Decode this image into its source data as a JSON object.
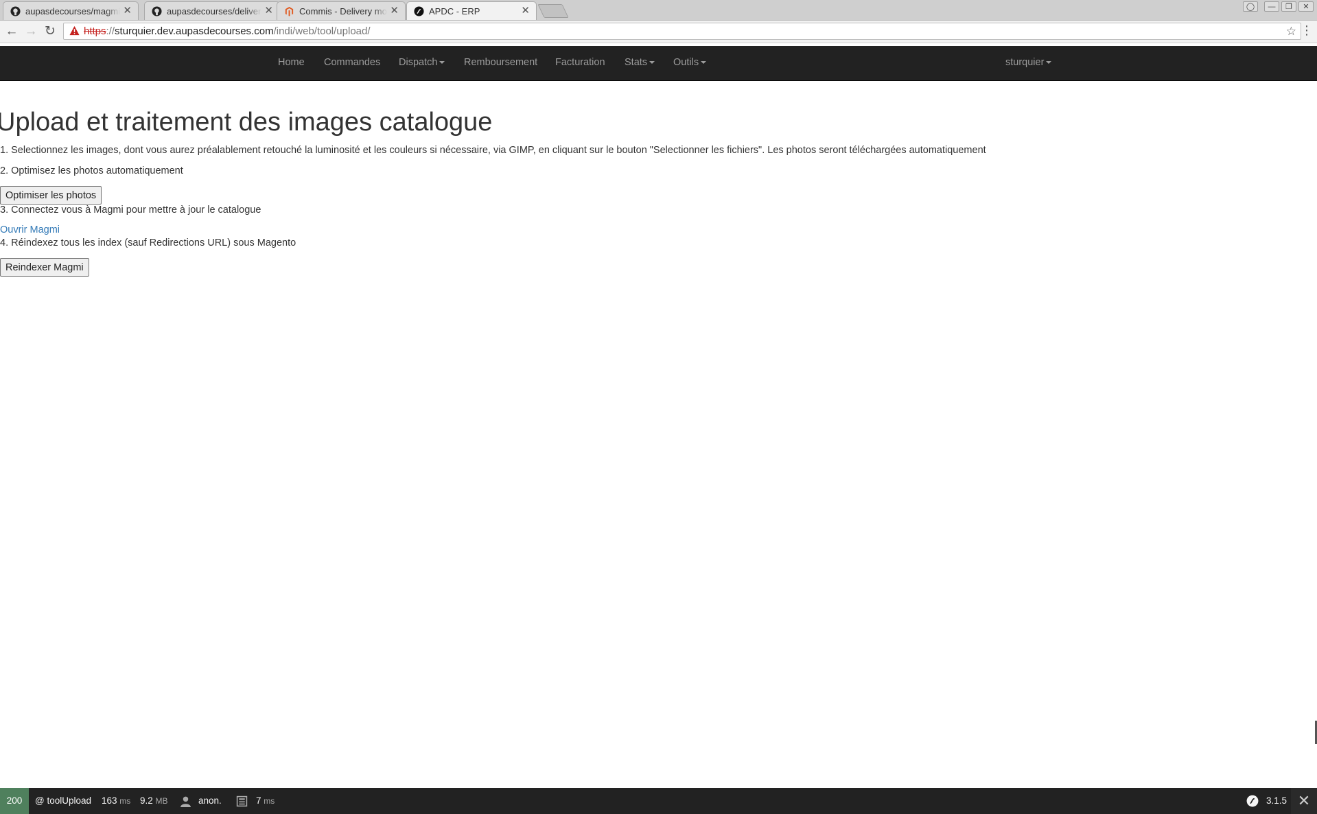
{
  "browser": {
    "tabs": [
      {
        "title": "aupasdecourses/magmi",
        "icon": "github-icon"
      },
      {
        "title": "aupasdecourses/delivery",
        "icon": "github-icon"
      },
      {
        "title": "Commis - Delivery module",
        "icon": "magento-icon"
      },
      {
        "title": "APDC - ERP",
        "icon": "symfony-icon"
      }
    ],
    "tab_close": "✕",
    "url": {
      "scheme": "https",
      "separator": "://",
      "host": "sturquier.dev.aupasdecourses.com",
      "path": "/indi/web/tool/upload/"
    }
  },
  "navbar": {
    "items": [
      "Home",
      "Commandes",
      "Dispatch",
      "Remboursement",
      "Facturation",
      "Stats",
      "Outils"
    ],
    "user": "sturquier"
  },
  "page": {
    "title": "Upload et traitement des images catalogue",
    "step1": "1. Selectionnez les images, dont vous aurez préalablement retouché la luminosité et les couleurs si nécessaire, via GIMP, en cliquant sur le bouton \"Selectionner les fichiers\". Les photos seront téléchargées automatiquement",
    "step2": "2. Optimisez les photos automatiquement",
    "optimize_button": "Optimiser les photos",
    "step3": "3. Connectez vous à Magmi pour mettre à jour le catalogue",
    "magmi_link": "Ouvrir Magmi",
    "step4": "4. Réindexez tous les index (sauf Redirections URL) sous Magento",
    "reindex_button": "Reindexer Magmi"
  },
  "debug_toolbar": {
    "status": "200",
    "route": "@ toolUpload",
    "time_value": "163",
    "time_unit": "ms",
    "memory_value": "9.2",
    "memory_unit": "MB",
    "user": "anon.",
    "db_time_value": "7",
    "db_time_unit": "ms",
    "symfony_version": "3.1.5",
    "colors": {
      "status_ok": "#4f805d",
      "bar_bg": "#222222"
    }
  }
}
